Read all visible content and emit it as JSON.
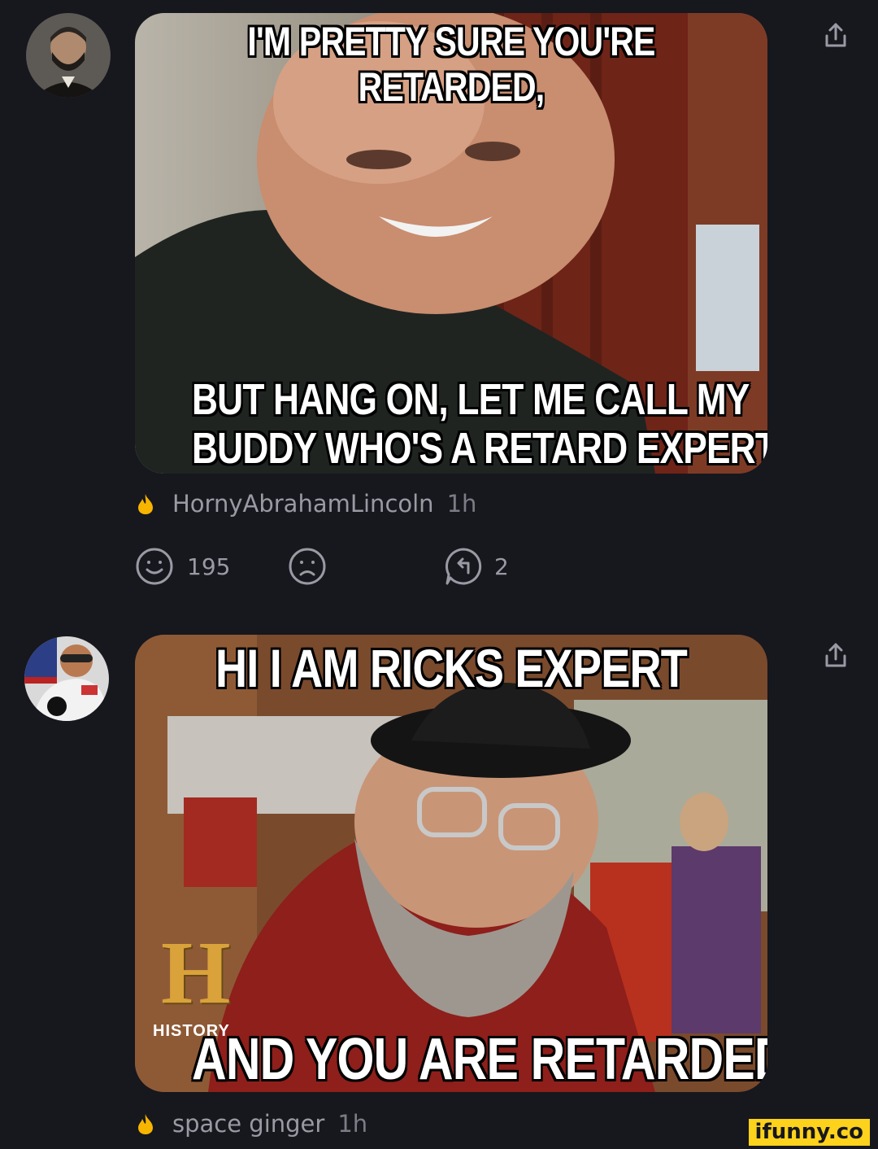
{
  "posts": [
    {
      "meme_top_line1": "I'M PRETTY SURE YOU'RE",
      "meme_top_line2": "RETARDED,",
      "meme_bottom_line1": "BUT HANG ON, LET ME CALL MY",
      "meme_bottom_line2": "BUDDY WHO'S A RETARD EXPERT.",
      "username": "HornyAbrahamLincoln",
      "time": "1h",
      "smile_count": "195",
      "reply_count": "2"
    },
    {
      "meme_top_line1": "HI I AM RICKS EXPERT",
      "meme_bottom_line1": "AND YOU ARE RETARDED",
      "channel_logo_letter": "H",
      "channel_logo_label": "HISTORY",
      "username": "space ginger",
      "time": "1h"
    }
  ],
  "watermark": "ifunny.co",
  "colors": {
    "background": "#17171e",
    "flame": "#f7b500",
    "icon": "#9a9aa4"
  },
  "icons": [
    "share-icon",
    "flame-icon",
    "smile-icon",
    "frown-icon",
    "reply-icon"
  ]
}
